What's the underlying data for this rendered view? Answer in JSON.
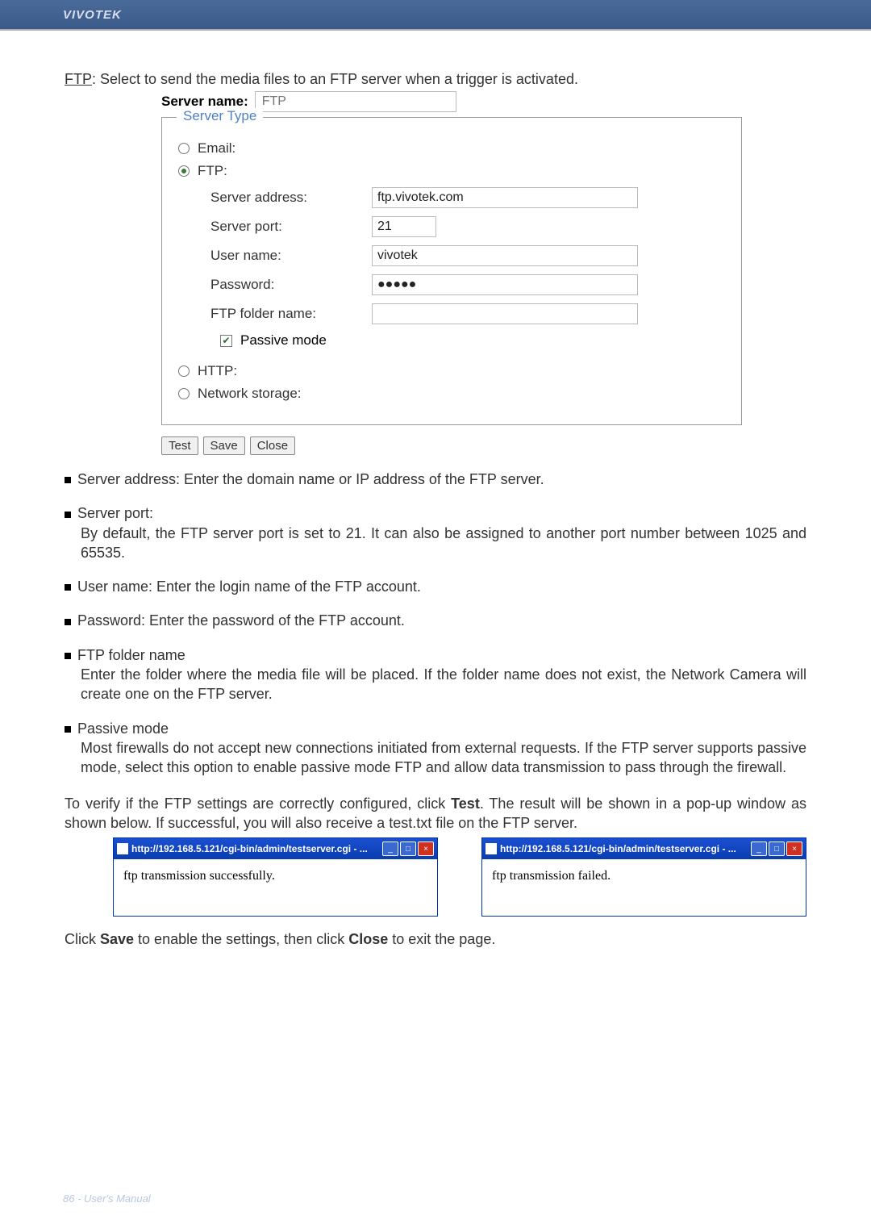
{
  "header": {
    "brand": "VIVOTEK"
  },
  "intro": {
    "ftp_label": "FTP",
    "text": ": Select to send the media files to an FTP server when a trigger is activated."
  },
  "form": {
    "server_name_label": "Server name:",
    "server_name_placeholder": "FTP",
    "fieldset_legend": "Server Type",
    "options": {
      "email": "Email:",
      "ftp": "FTP:",
      "http": "HTTP:",
      "network_storage": "Network storage:"
    },
    "ftp_fields": {
      "server_address_label": "Server address:",
      "server_address_value": "ftp.vivotek.com",
      "server_port_label": "Server port:",
      "server_port_value": "21",
      "user_name_label": "User name:",
      "user_name_value": "vivotek",
      "password_label": "Password:",
      "password_value": "●●●●●",
      "ftp_folder_label": "FTP folder name:",
      "ftp_folder_value": "",
      "passive_mode_label": "Passive mode"
    },
    "buttons": {
      "test": "Test",
      "save": "Save",
      "close": "Close"
    }
  },
  "descriptions": {
    "server_address": "Server address: Enter the domain name or IP address of the FTP server.",
    "server_port_title": "Server port:",
    "server_port_body": "By default, the FTP server port is set to 21. It can also be assigned to another port number between 1025 and 65535.",
    "user_name": "User name: Enter the login name of the FTP account.",
    "password": "Password: Enter the password of the FTP account.",
    "ftp_folder_title": "FTP folder name",
    "ftp_folder_body": "Enter the folder where the media file will be placed. If the folder name does not exist, the Network Camera will create one on the FTP server.",
    "passive_title": "Passive mode",
    "passive_body": "Most firewalls do not accept new connections initiated from external requests. If the FTP server supports passive mode, select this option to enable passive mode FTP and allow data transmission to pass through the firewall."
  },
  "verify_text_pre": "To verify if the FTP settings are correctly configured, click ",
  "verify_text_bold": "Test",
  "verify_text_post": ". The result will be shown in a pop-up window as shown below. If successful, you will also receive a test.txt file on the FTP server.",
  "popups": {
    "title": "http://192.168.5.121/cgi-bin/admin/testserver.cgi - ...",
    "success_body": "ftp transmission successfully.",
    "fail_body": "ftp transmission failed."
  },
  "final_text_pre": "Click ",
  "final_text_save": "Save",
  "final_text_mid": " to enable the settings, then click ",
  "final_text_close": "Close",
  "final_text_post": " to exit the page.",
  "footer": {
    "page_number": "86",
    "label": " - User's Manual"
  }
}
